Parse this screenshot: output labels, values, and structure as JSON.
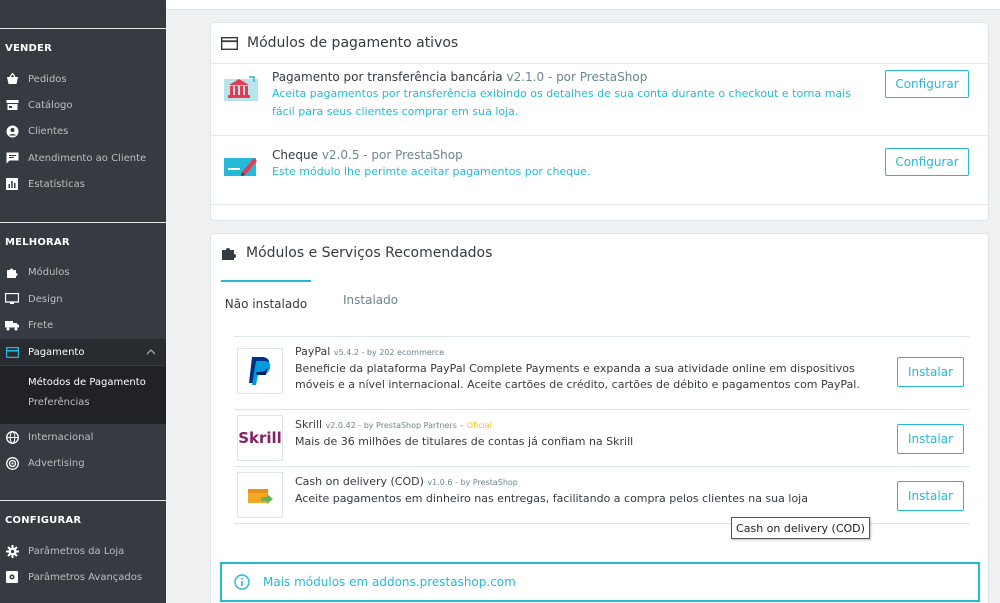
{
  "sidebar": {
    "sections": [
      {
        "title": "VENDER"
      },
      {
        "title": "MELHORAR"
      },
      {
        "title": "CONFIGURAR"
      }
    ],
    "items": [
      {
        "label": "Pedidos",
        "icon": "shopping-basket-icon"
      },
      {
        "label": "Catálogo",
        "icon": "store-icon"
      },
      {
        "label": "Clientes",
        "icon": "account-circle-icon"
      },
      {
        "label": "Atendimento ao Cliente",
        "icon": "chat-icon"
      },
      {
        "label": "Estatísticas",
        "icon": "bar-chart-icon"
      },
      {
        "label": "Módulos",
        "icon": "puzzle-icon"
      },
      {
        "label": "Design",
        "icon": "desktop-icon"
      },
      {
        "label": "Frete",
        "icon": "truck-icon"
      },
      {
        "label": "Pagamento",
        "icon": "payment-card-icon"
      },
      {
        "label": "Internacional",
        "icon": "globe-icon"
      },
      {
        "label": "Advertising",
        "icon": "target-icon"
      },
      {
        "label": "Parâmetros da Loja",
        "icon": "gear-icon"
      },
      {
        "label": "Parâmetros Avançados",
        "icon": "settings-box-icon"
      }
    ],
    "subitems": [
      {
        "label": "Métodos de Pagamento"
      },
      {
        "label": "Preferências"
      }
    ]
  },
  "active_panel": {
    "title": "Módulos de pagamento ativos",
    "modules": [
      {
        "name": "Pagamento por transferência bancária",
        "version": "v2.1.0 - por PrestaShop",
        "description": "Aceita pagamentos por transferência exibindo os detalhes de sua conta durante o checkout e torna mais fácil para seus clientes comprar em sua loja.",
        "button": "Configurar"
      },
      {
        "name": "Cheque",
        "version": "v2.0.5 - por PrestaShop",
        "description": "Este módulo lhe perimte aceitar pagamentos por cheque.",
        "button": "Configurar"
      }
    ]
  },
  "recommended_panel": {
    "title": "Módulos e Serviços Recomendados",
    "tabs": [
      {
        "label": "Não instalado"
      },
      {
        "label": "Instalado"
      }
    ],
    "modules": [
      {
        "name": "PayPal",
        "meta": "v5.4.2 - by 202 ecommerce",
        "official": "",
        "description": "Beneficie da plataforma PayPal Complete Payments e expanda a sua atividade online em dispositivos móveis e a nível internacional. Aceite cartões de crédito, cartões de débito e pagamentos com PayPal.",
        "button": "Instalar"
      },
      {
        "name": "Skrill",
        "meta": "v2.0.42 - by PrestaShop Partners",
        "official": "Oficial",
        "description": "Mais de 36 milhões de titulares de contas já confiam na Skrill",
        "button": "Instalar"
      },
      {
        "name": "Cash on delivery (COD)",
        "meta": "v1.0.6 - by PrestaShop",
        "official": "",
        "description": "Aceite pagamentos em dinheiro nas entregas, facilitando a compra pelos clientes na sua loja",
        "button": "Instalar"
      }
    ],
    "tooltip": "Cash on delivery (COD)",
    "info_link": "Mais módulos em addons.prestashop.com"
  },
  "skrill_logo_text": "Skrill",
  "colors": {
    "sidebar_bg": "#363a41",
    "accent": "#25b9d7",
    "official": "#fbbb22"
  }
}
